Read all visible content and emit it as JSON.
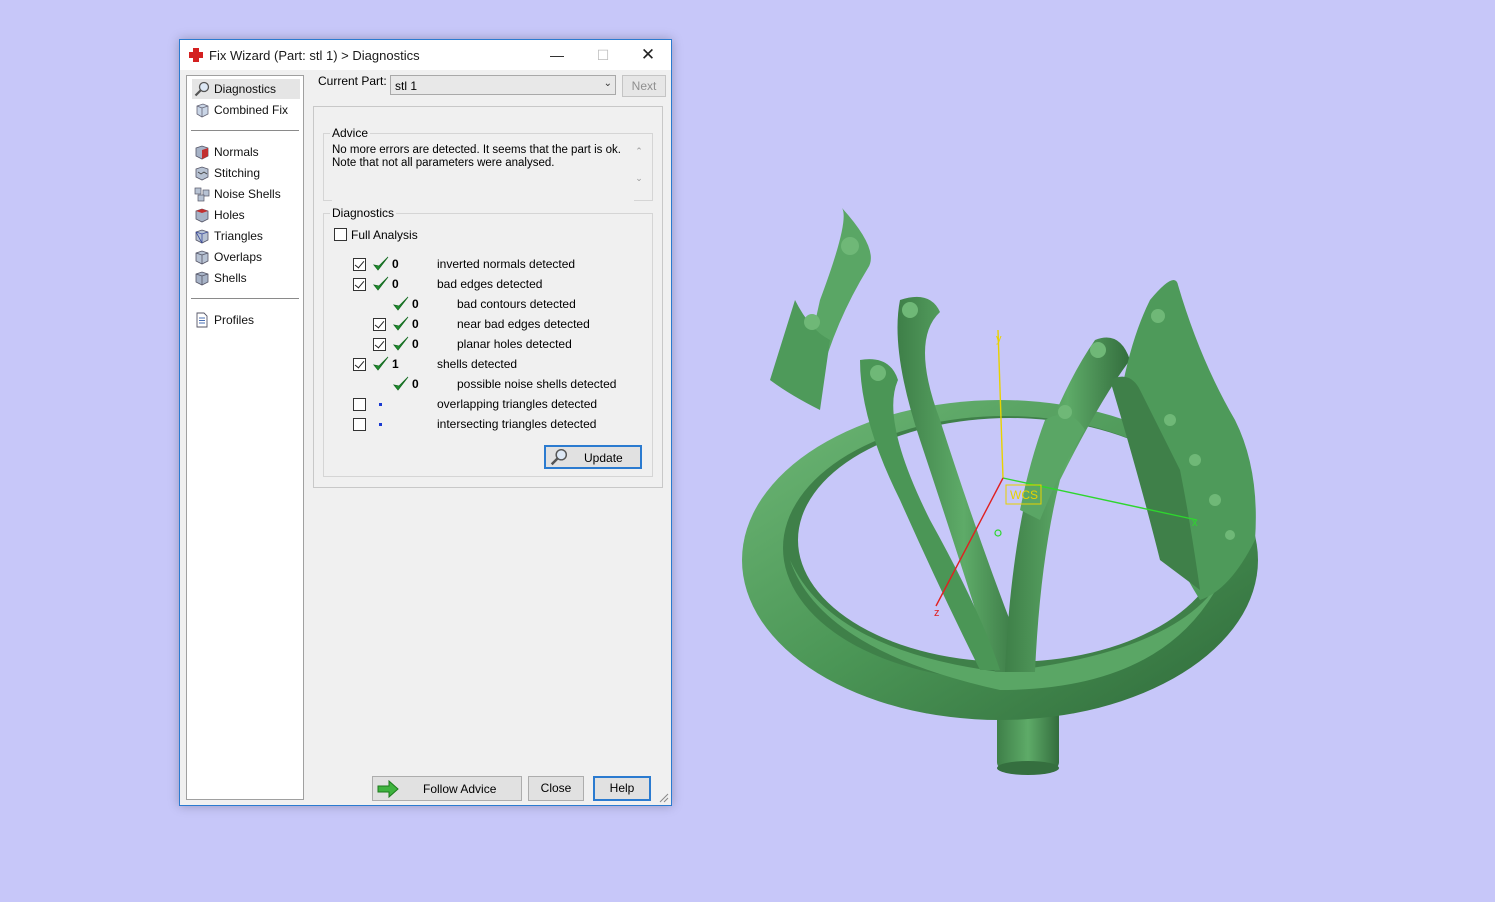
{
  "window": {
    "title": "Fix Wizard (Part: stl 1) > Diagnostics"
  },
  "nav": {
    "group1": [
      {
        "label": "Diagnostics",
        "icon": "magnifier-icon",
        "selected": true
      },
      {
        "label": "Combined Fix",
        "icon": "cube-icon"
      }
    ],
    "group2": [
      {
        "label": "Normals",
        "icon": "normals-cube-icon"
      },
      {
        "label": "Stitching",
        "icon": "stitching-cube-icon"
      },
      {
        "label": "Noise Shells",
        "icon": "noise-shells-icon"
      },
      {
        "label": "Holes",
        "icon": "holes-cube-icon"
      },
      {
        "label": "Triangles",
        "icon": "triangles-cube-icon"
      },
      {
        "label": "Overlaps",
        "icon": "overlaps-cube-icon"
      },
      {
        "label": "Shells",
        "icon": "shells-cube-icon"
      }
    ],
    "group3": [
      {
        "label": "Profiles",
        "icon": "document-icon"
      }
    ]
  },
  "current_part": {
    "label": "Current Part:",
    "value": "stl 1",
    "next_label": "Next"
  },
  "advice": {
    "title": "Advice",
    "text_line1": "No more errors are detected. It seems that the part is ok.",
    "text_line2": "Note that not all parameters were analysed."
  },
  "diagnostics": {
    "title": "Diagnostics",
    "full_analysis_label": "Full Analysis",
    "full_analysis_checked": false,
    "rows": [
      {
        "checkbox": true,
        "checked": true,
        "status": "ok",
        "count": "0",
        "label": "inverted normals detected",
        "indent": 0
      },
      {
        "checkbox": true,
        "checked": true,
        "status": "ok",
        "count": "0",
        "label": "bad edges detected",
        "indent": 0
      },
      {
        "checkbox": false,
        "checked": false,
        "status": "ok",
        "count": "0",
        "label": "bad contours detected",
        "indent": 1
      },
      {
        "checkbox": true,
        "checked": true,
        "status": "ok",
        "count": "0",
        "label": "near bad edges detected",
        "indent": 1
      },
      {
        "checkbox": true,
        "checked": true,
        "status": "ok",
        "count": "0",
        "label": "planar holes detected",
        "indent": 1
      },
      {
        "checkbox": true,
        "checked": true,
        "status": "ok",
        "count": "1",
        "label": "shells detected",
        "indent": 0
      },
      {
        "checkbox": false,
        "checked": false,
        "status": "ok",
        "count": "0",
        "label": "possible noise shells detected",
        "indent": 1
      },
      {
        "checkbox": true,
        "checked": false,
        "status": "unknown",
        "count": "",
        "label": "overlapping triangles detected",
        "indent": 0
      },
      {
        "checkbox": true,
        "checked": false,
        "status": "unknown",
        "count": "",
        "label": "intersecting triangles detected",
        "indent": 0
      }
    ],
    "update_label": "Update"
  },
  "footer": {
    "follow_advice_label": "Follow Advice",
    "close_label": "Close",
    "help_label": "Help"
  },
  "viewport": {
    "background": "#c7c7f9",
    "model_color": "#4e9a5a",
    "wcs_label": "WCS",
    "axis_y": "y",
    "axis_x": "x",
    "axis_z": "z"
  }
}
